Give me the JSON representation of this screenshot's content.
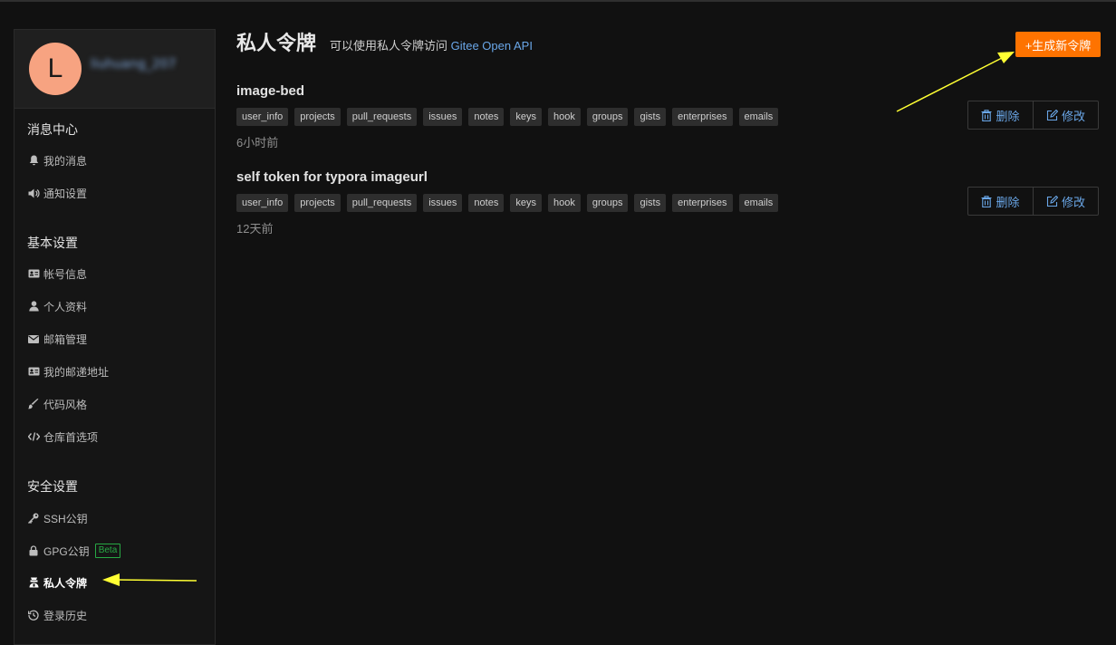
{
  "sidebar": {
    "avatar_letter": "L",
    "username": "liuhuang_207",
    "groups": [
      {
        "title": "消息中心",
        "items": [
          {
            "label": "我的消息",
            "icon": "bell-icon"
          },
          {
            "label": "通知设置",
            "icon": "volume-icon"
          }
        ]
      },
      {
        "title": "基本设置",
        "items": [
          {
            "label": "帐号信息",
            "icon": "id-card-icon"
          },
          {
            "label": "个人资料",
            "icon": "user-icon"
          },
          {
            "label": "邮箱管理",
            "icon": "envelope-icon"
          },
          {
            "label": "我的邮递地址",
            "icon": "address-card-icon"
          },
          {
            "label": "代码风格",
            "icon": "brush-icon"
          },
          {
            "label": "仓库首选项",
            "icon": "code-icon"
          }
        ]
      },
      {
        "title": "安全设置",
        "items": [
          {
            "label": "SSH公钥",
            "icon": "key-icon"
          },
          {
            "label": "GPG公钥",
            "icon": "lock-icon",
            "badge": "Beta"
          },
          {
            "label": "私人令牌",
            "icon": "token-icon",
            "active": true
          },
          {
            "label": "登录历史",
            "icon": "history-icon"
          }
        ]
      }
    ]
  },
  "header": {
    "title": "私人令牌",
    "subtitle_prefix": "可以使用私人令牌访问 ",
    "subtitle_link": "Gitee Open API",
    "generate_button": "+生成新令牌"
  },
  "tokens": [
    {
      "name": "image-bed",
      "scopes": [
        "user_info",
        "projects",
        "pull_requests",
        "issues",
        "notes",
        "keys",
        "hook",
        "groups",
        "gists",
        "enterprises",
        "emails"
      ],
      "time": "6小时前",
      "delete_label": "删除",
      "edit_label": "修改"
    },
    {
      "name": "self token for typora imageurl",
      "scopes": [
        "user_info",
        "projects",
        "pull_requests",
        "issues",
        "notes",
        "keys",
        "hook",
        "groups",
        "gists",
        "enterprises",
        "emails"
      ],
      "time": "12天前",
      "delete_label": "删除",
      "edit_label": "修改"
    }
  ],
  "colors": {
    "accent": "#fe7300",
    "link": "#6aa7e8",
    "annotation_arrow": "#ffff33"
  }
}
